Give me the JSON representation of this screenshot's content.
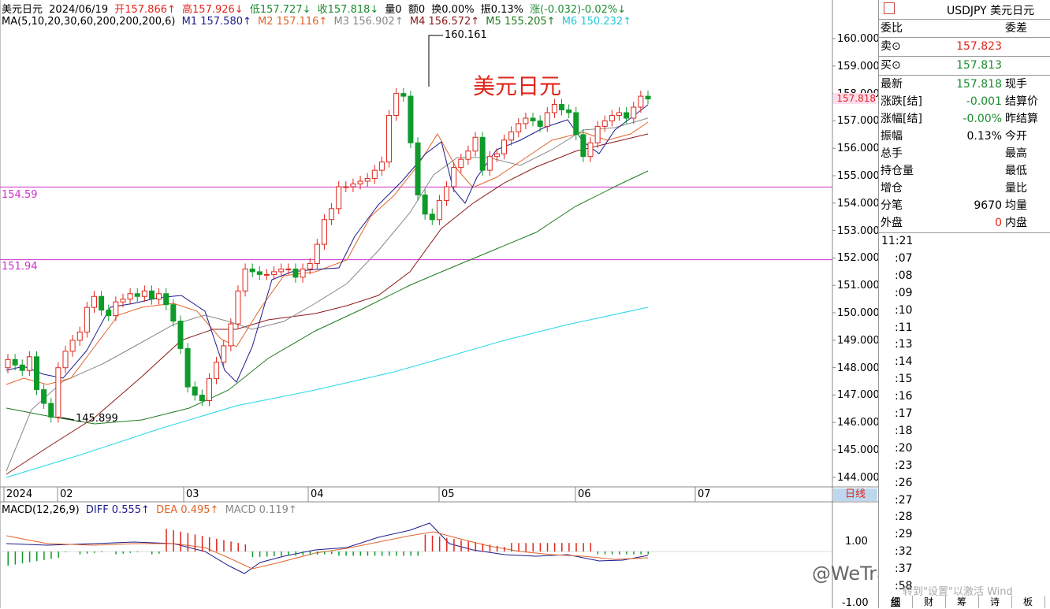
{
  "header": {
    "name": "美元日元",
    "date": "2024/06/19",
    "open": "开157.866↑",
    "high": "高157.926↓",
    "low": "低157.727↓",
    "close": "收157.818↓",
    "volume": "量0",
    "amount": "额0",
    "turnover": "换0.00%",
    "amplitude": "振0.13%",
    "change": "涨(-0.032)-0.02%↓"
  },
  "ma_line": {
    "label": "MA(5,10,20,30,60,200,200,200,6)",
    "m1": "M1 157.580↑",
    "m2": "M2 157.116↑",
    "m3": "M3 156.902↑",
    "m4": "M4 156.572↑",
    "m5": "M5 155.205↑",
    "m6": "M6 150.232↑"
  },
  "chart_title": "美元日元",
  "annotations": {
    "peak": "160.161",
    "trough": "145.899",
    "hline1": "154.59",
    "hline2": "151.94"
  },
  "price_axis": [
    "160.000",
    "159.000",
    "158.000",
    "157.000",
    "156.000",
    "155.000",
    "154.000",
    "153.000",
    "152.000",
    "151.000",
    "150.000",
    "149.000",
    "148.000",
    "147.000",
    "146.000",
    "145.000",
    "144.000"
  ],
  "price_marker": "157.818",
  "time_axis": [
    "2024",
    "02",
    "03",
    "04",
    "05",
    "06",
    "07"
  ],
  "period_button": "日线",
  "macd": {
    "label": "MACD(12,26,9)",
    "diff": "DIFF 0.555↑",
    "dea": "DEA 0.495↑",
    "macd": "MACD 0.119↑",
    "axis": [
      "1.00",
      "-1.00"
    ]
  },
  "right_panel": {
    "symbol": "USDJPY 美元日元",
    "weibi_label": "委比",
    "weicha_label": "委差",
    "sell_label": "卖⊙",
    "sell_value": "157.823",
    "buy_label": "买⊙",
    "buy_value": "157.813",
    "rows": [
      {
        "label": "最新",
        "value": "157.818",
        "right": "现手",
        "color": "green"
      },
      {
        "label": "涨跌[结]",
        "value": "-0.001",
        "right": "结算价",
        "color": "green"
      },
      {
        "label": "涨幅[结]",
        "value": "-0.00%",
        "right": "昨结算",
        "color": "green"
      },
      {
        "label": "振幅",
        "value": "0.13%",
        "right": "今开",
        "color": "black"
      },
      {
        "label": "总手",
        "value": "",
        "right": "最高",
        "color": "black"
      },
      {
        "label": "持仓量",
        "value": "",
        "right": "最低",
        "color": "black"
      },
      {
        "label": "增仓",
        "value": "",
        "right": "量比",
        "color": "black"
      },
      {
        "label": "分笔",
        "value": "9670",
        "right": "均量",
        "color": "black"
      },
      {
        "label": "外盘",
        "value": "0",
        "right": "内盘",
        "color": "red"
      }
    ],
    "times": [
      "11:21",
      ":07",
      ":08",
      ":09",
      ":10",
      ":11",
      ":13",
      ":14",
      ":15",
      ":16",
      ":17",
      ":18",
      ":20",
      ":23",
      ":26",
      ":27",
      ":28",
      ":29",
      ":32",
      ":37",
      ":58"
    ],
    "tabs": [
      "细",
      "财",
      "筹",
      "诗",
      "板"
    ]
  },
  "watermark": "@WeTrade众汇 官方",
  "activation": "转到\"设置\"以激活 Wind",
  "colors": {
    "up": "#e0261c",
    "down": "#0f9b2a",
    "m1": "#1c1c8c",
    "m2": "#e0652b",
    "m3": "#888888",
    "m4": "#8b1a1a",
    "m5": "#1e7b1e",
    "m6": "#22d8e8",
    "hline": "#cc33cc"
  }
}
